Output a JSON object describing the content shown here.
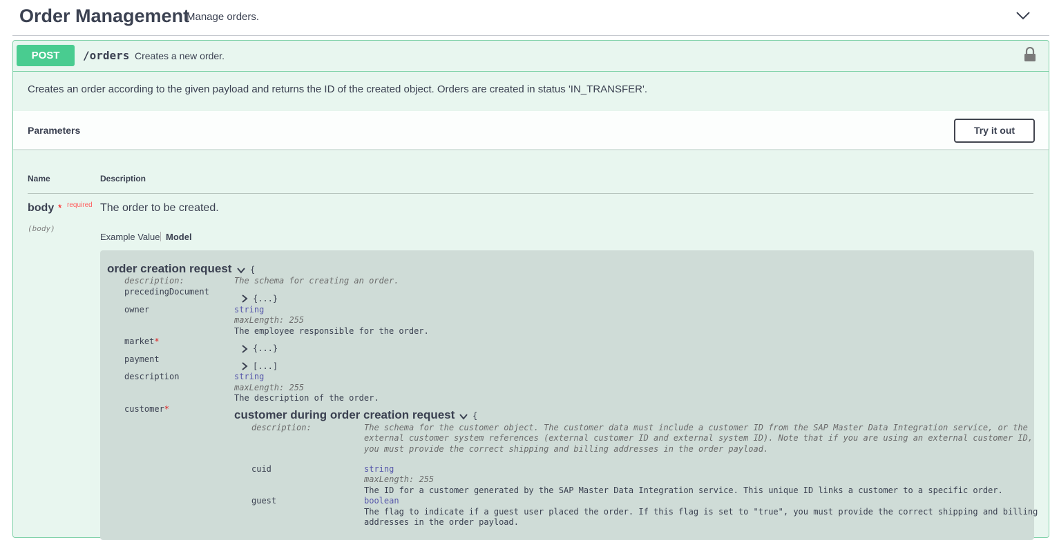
{
  "tag": {
    "title": "Order Management",
    "description": "Manage orders."
  },
  "operation": {
    "method": "POST",
    "path": "/orders",
    "summary": "Creates a new order.",
    "description": "Creates an order according to the given payload and returns the ID of the created object. Orders are created in status 'IN_TRANSFER'."
  },
  "parameters": {
    "title": "Parameters",
    "try_label": "Try it out",
    "col_name": "Name",
    "col_desc": "Description",
    "param": {
      "name": "body",
      "star": "*",
      "required": "required",
      "in": "(body)",
      "description": "The order to be created."
    },
    "tabs": {
      "example": "Example Value",
      "model": "Model"
    }
  },
  "model": {
    "title": "order creation request",
    "open_brace": "{",
    "description_key": "description:",
    "description_val": "The schema for creating an order.",
    "preceding": {
      "key": "precedingDocument",
      "collapsed": "{...}"
    },
    "owner": {
      "key": "owner",
      "type": "string",
      "max": "maxLength: 255",
      "desc": "The employee responsible for the order."
    },
    "market": {
      "key": "market",
      "star": "*",
      "collapsed": "{...}"
    },
    "payment": {
      "key": "payment",
      "collapsed": "[...]"
    },
    "description": {
      "key": "description",
      "type": "string",
      "max": "maxLength: 255",
      "desc": "The description of the order."
    },
    "customer": {
      "key": "customer",
      "star": "*",
      "title": "customer during order creation request",
      "open_brace": "{",
      "description_key": "description:",
      "description_lines": [
        "The schema for the customer object. The customer data must include a customer ID from the SAP Master Data Integration service, or the",
        "external customer system references (external customer ID and external system ID). Note that if you are using an external customer ID,",
        "you must provide the correct shipping and billing addresses in the order payload."
      ],
      "cuid": {
        "key": "cuid",
        "type": "string",
        "max": "maxLength: 255",
        "desc": "The ID for a customer generated by the SAP Master Data Integration service. This unique ID links a customer to a specific order."
      },
      "guest": {
        "key": "guest",
        "type": "boolean",
        "desc_lines": [
          "The flag to indicate if a guest user placed the order. If this flag is set to \"true\", you must provide the correct shipping and billing",
          "addresses in the order payload."
        ]
      }
    }
  },
  "colors": {
    "post": "#49cc90",
    "post_bg": "#e8f6ef",
    "post_border": "#7fd1a8",
    "model_bg": "#cfdcd7"
  },
  "icons": {
    "collapse": "chevron-down-icon",
    "lock": "lock-icon",
    "expand": "chevron-right-icon"
  }
}
